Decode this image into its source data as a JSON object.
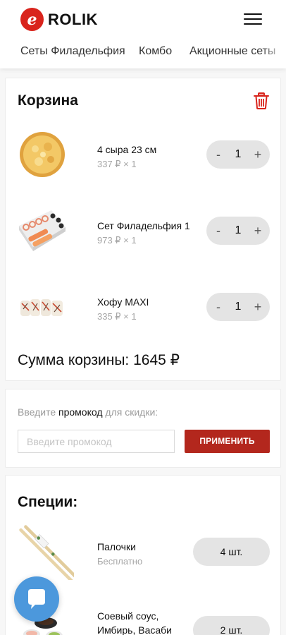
{
  "header": {
    "logo_letter": "e",
    "logo_text": "ROLIK",
    "menu_icon": "hamburger-icon"
  },
  "categories": [
    "Сеты Филадельфия",
    "Комбо",
    "Акционные сеты"
  ],
  "cart": {
    "title": "Корзина",
    "delete_icon": "trash-icon",
    "items": [
      {
        "name": "4 сыра 23 см",
        "price": "337 ₽ × 1",
        "qty": "1",
        "image": "pizza"
      },
      {
        "name": "Сет Филадельфия 1",
        "price": "973 ₽ × 1",
        "qty": "1",
        "image": "sushi-set"
      },
      {
        "name": "Хофу MAXI",
        "price": "335 ₽ × 1",
        "qty": "1",
        "image": "rolls"
      }
    ],
    "minus": "-",
    "plus": "+",
    "total": "Сумма корзины: 1645 ₽"
  },
  "promo": {
    "label_before": "Введите ",
    "label_bold": "промокод",
    "label_after": " для скидки:",
    "placeholder": "Введите промокод",
    "button": "ПРИМЕНИТЬ"
  },
  "spices": {
    "title": "Специи:",
    "items": [
      {
        "name": "Палочки",
        "price": "Бесплатно",
        "count": "4 шт.",
        "image": "chopsticks"
      },
      {
        "name": "Соевый соус, Имбирь, Васаби",
        "count": "2 шт.",
        "image": "sauces"
      }
    ]
  },
  "colors": {
    "brand": "#d9241c",
    "button": "#b3271d",
    "chat": "#4c98dc"
  },
  "chat_icon": "chat-bubble-icon"
}
